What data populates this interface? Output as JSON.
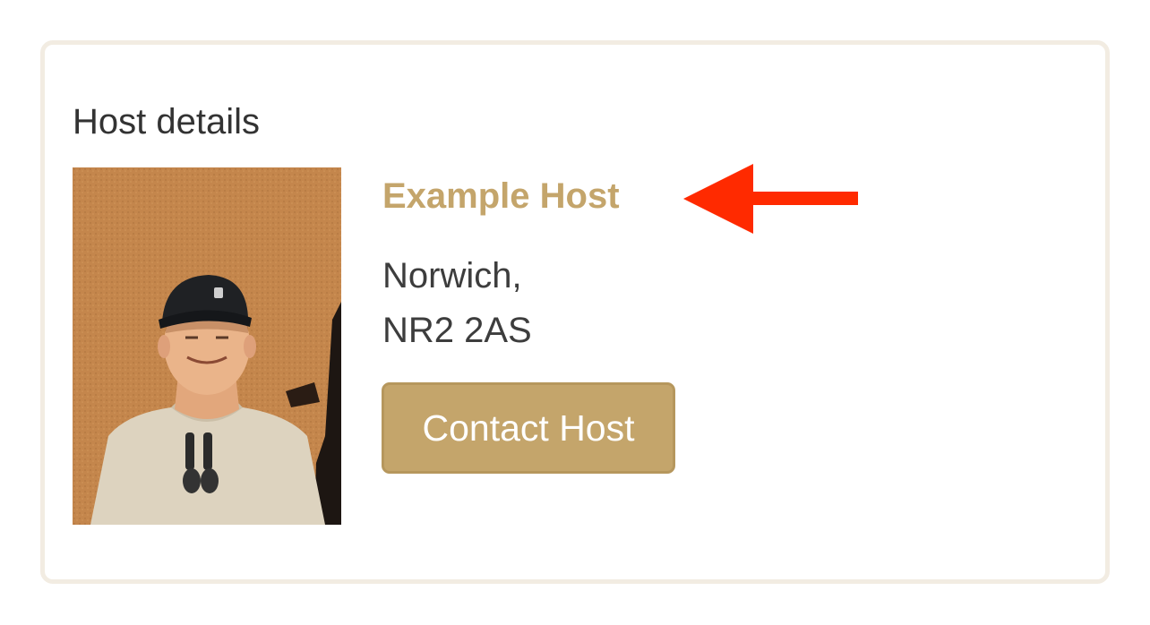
{
  "host_details": {
    "title": "Host details",
    "photo_alt": "Host photo",
    "host_name": "Example Host",
    "address_lines": [
      "Norwich,",
      "NR2 2AS"
    ],
    "contact_label": "Contact Host"
  },
  "annotation": {
    "icon": "arrow-left-icon",
    "color": "#ff2a00"
  },
  "colors": {
    "accent": "#c4a56b",
    "card_border": "#f2ece2",
    "text": "#3d3d3d"
  }
}
